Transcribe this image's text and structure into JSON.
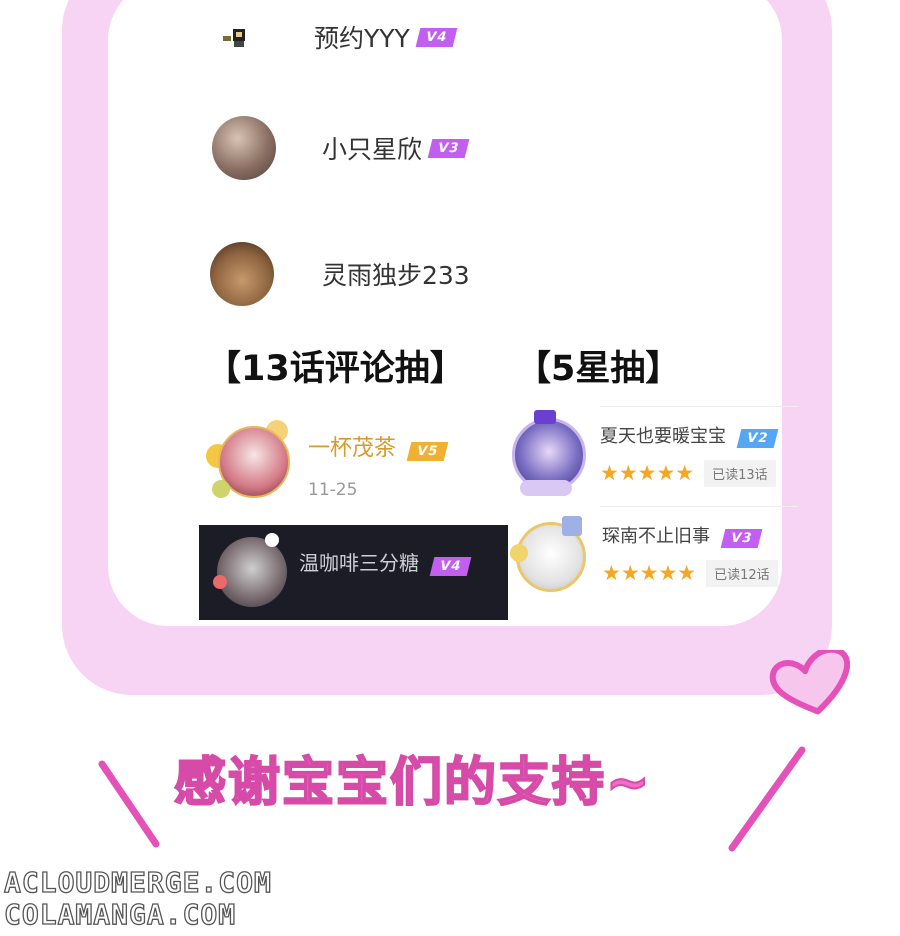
{
  "top_list": [
    {
      "name": "预约YYY",
      "badge": "V4"
    },
    {
      "name": "小只星欣",
      "badge": "V3"
    },
    {
      "name": "灵雨独步233",
      "badge": ""
    }
  ],
  "sections": {
    "left_title": "【13话评论抽】",
    "right_title": "【5星抽】"
  },
  "left_winners": [
    {
      "name": "一杯茂茶",
      "badge": "V5",
      "date": "11-25"
    },
    {
      "name": "温咖啡三分糖",
      "badge": "V4"
    }
  ],
  "right_winners": [
    {
      "name": "夏天也要暖宝宝",
      "badge": "V2",
      "stars": "★★★★★",
      "read": "已读13话"
    },
    {
      "name": "琛南不止旧事",
      "badge": "V3",
      "stars": "★★★★★",
      "read": "已读12话"
    }
  ],
  "footer": {
    "thanks": "感谢宝宝们的支持~",
    "watermark_1": "ACLOUDMERGE.COM",
    "watermark_2": "COLAMANGA.COM"
  },
  "colors": {
    "frame_pink": "#f8d4f4",
    "badge_purple": "#c25ef0",
    "badge_gold": "#f0b132",
    "badge_blue": "#55a7f5",
    "star": "#f5a623",
    "thanks_pink": "#f26fc7"
  }
}
